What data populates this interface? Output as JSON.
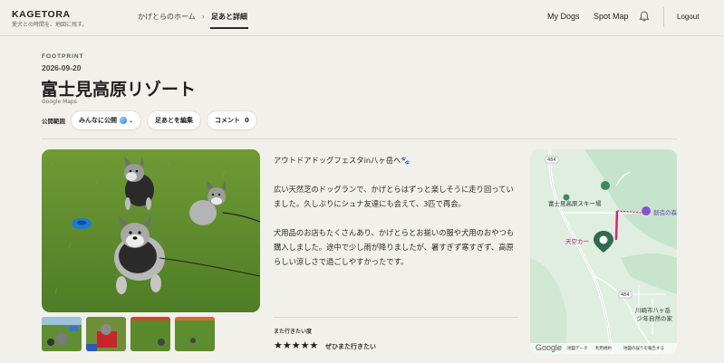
{
  "header": {
    "brand": "KAGETORA",
    "tagline": "愛犬との時間を、地図に残す。",
    "breadcrumb": {
      "home": "かげとらのホーム",
      "sep": "›",
      "current": "足あと詳細"
    },
    "nav": {
      "my_dogs": "My Dogs",
      "spot_map": "Spot Map",
      "logout": "Logout"
    }
  },
  "footprint": {
    "kicker": "FOOTPRINT",
    "date": "2026-09-20",
    "title": "富士見高原リゾート",
    "source": "Google Maps",
    "visibility_label": "公開範囲",
    "visibility_value": "みんなに公開",
    "edit_label": "足あとを編集",
    "comment_label": "コメント",
    "comment_count": "0"
  },
  "post": {
    "paragraphs": [
      "アウトドアドッグフェスタin八ヶ岳へ🐾",
      "広い天然芝のドッグランで、かげとらはずっと楽しそうに走り回っていました。久しぶりにシュナ友達にも会えて、3匹で再会。",
      "犬用品のお店もたくさんあり、かげとらとお揃いの服や犬用のおやつも購入しました。途中で少し雨が降りましたが、暑すぎず寒すぎず、高原らしい涼しさで過ごしやすかったです。"
    ]
  },
  "rating": {
    "label": "また行きたい度",
    "stars": "★★★★★",
    "value": 5,
    "text": "ぜひまた行きたい"
  },
  "map": {
    "logo": "Google",
    "labels": {
      "road_484_top": "484",
      "ski": "富士見高原スキー場",
      "creation": "創造の森",
      "tenku": "天空カー",
      "road_484_bottom": "484",
      "kawasaki": "川崎市八ヶ岳",
      "youth": "少年自然の家"
    },
    "footer": {
      "data": "地図データ",
      "terms": "利用規約",
      "report": "地図の誤りを報告する"
    }
  },
  "colors": {
    "background": "#f2f0ea",
    "grass": "#5d8a2c",
    "map_green": "#c9e6cf",
    "route": "#d6247a",
    "pin": "#2f6b4f"
  }
}
